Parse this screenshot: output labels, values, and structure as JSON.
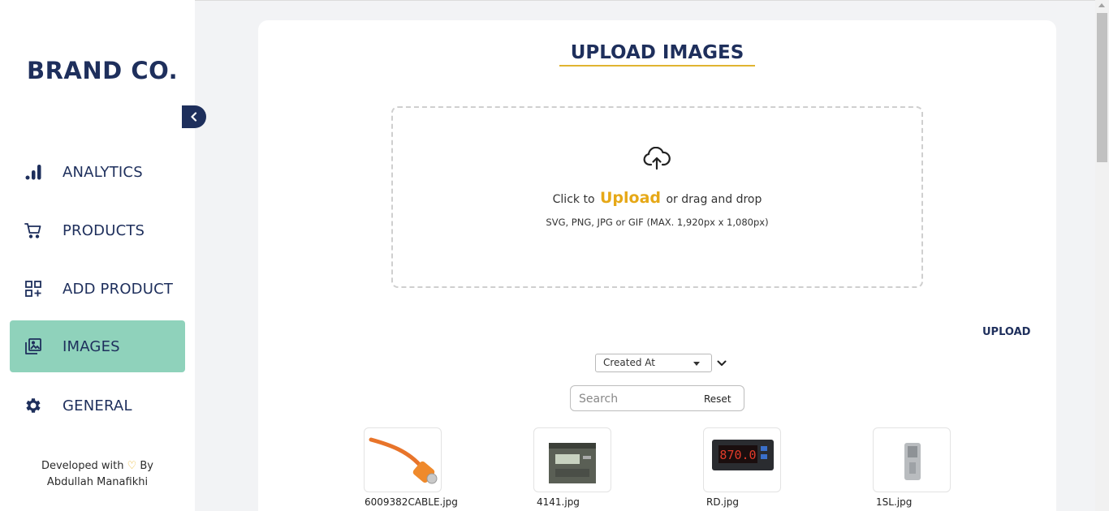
{
  "brand": "BRAND CO.",
  "sidebar": {
    "items": [
      {
        "label": "ANALYTICS",
        "icon": "bar-chart-icon"
      },
      {
        "label": "PRODUCTS",
        "icon": "cart-icon"
      },
      {
        "label": "ADD PRODUCT",
        "icon": "add-grid-icon"
      },
      {
        "label": "IMAGES",
        "icon": "images-icon",
        "active": true
      },
      {
        "label": "GENERAL",
        "icon": "gear-icon"
      }
    ],
    "footer_prefix": "Developed with",
    "footer_by": "By",
    "footer_author": "Abdullah Manafikhi"
  },
  "main": {
    "title": "UPLOAD IMAGES",
    "dropzone": {
      "prefix": "Click to",
      "upload_link": "Upload",
      "suffix": "or drag and drop",
      "hint": "SVG, PNG, JPG or GIF (MAX. 1,920px x 1,080px)"
    },
    "upload_button": "UPLOAD",
    "sort": {
      "selected": "Created At"
    },
    "search": {
      "placeholder": "Search",
      "reset_label": "Reset"
    },
    "images": [
      {
        "name": "6009382CABLE.jpg"
      },
      {
        "name": "4141.jpg"
      },
      {
        "name": "RD.jpg"
      },
      {
        "name": "1SL.jpg"
      }
    ]
  },
  "colors": {
    "accent": "#e6a817",
    "brand": "#1e2f5c",
    "active_nav": "#8fd2bb"
  }
}
